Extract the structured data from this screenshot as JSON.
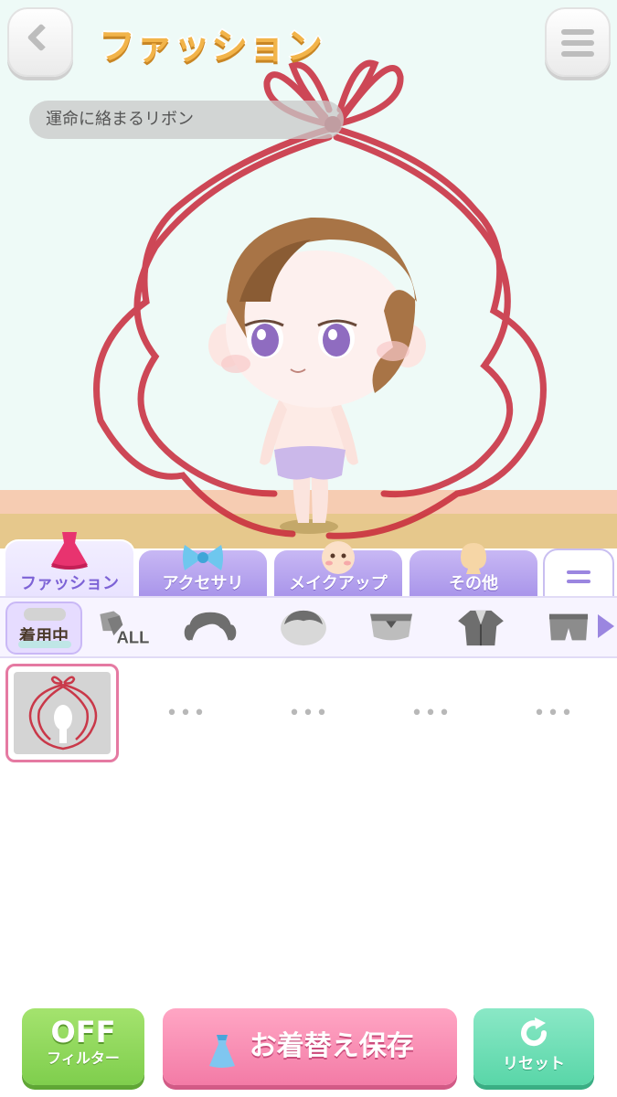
{
  "header": {
    "title": "ファッション"
  },
  "preview": {
    "item_name": "運命に絡まるリボン"
  },
  "tabs": [
    {
      "label": "ファッション",
      "icon": "dress-icon",
      "active": true
    },
    {
      "label": "アクセサリ",
      "icon": "bow-icon",
      "active": false
    },
    {
      "label": "メイクアップ",
      "icon": "face-icon",
      "active": false
    },
    {
      "label": "その他",
      "icon": "head-silhouette-icon",
      "active": false
    }
  ],
  "subcategories": {
    "equipped_label": "着用中",
    "all_label": "ALL",
    "icons": [
      "all-clothes-icon",
      "hair-icon",
      "head-icon",
      "top-icon",
      "outerwear-icon",
      "bottoms-icon"
    ]
  },
  "items": {
    "selected_name": "運命に絡まるリボン",
    "placeholder": "•••"
  },
  "bottom": {
    "filter_big": "OFF",
    "filter_small": "フィルター",
    "save_label": "お着替え保存",
    "reset_label": "リセット"
  },
  "colors": {
    "accent_purple": "#a894ea",
    "save_pink": "#f37ba6",
    "filter_green": "#7fce4d",
    "reset_mint": "#59d6a8",
    "ribbon_red": "#c8283a"
  }
}
